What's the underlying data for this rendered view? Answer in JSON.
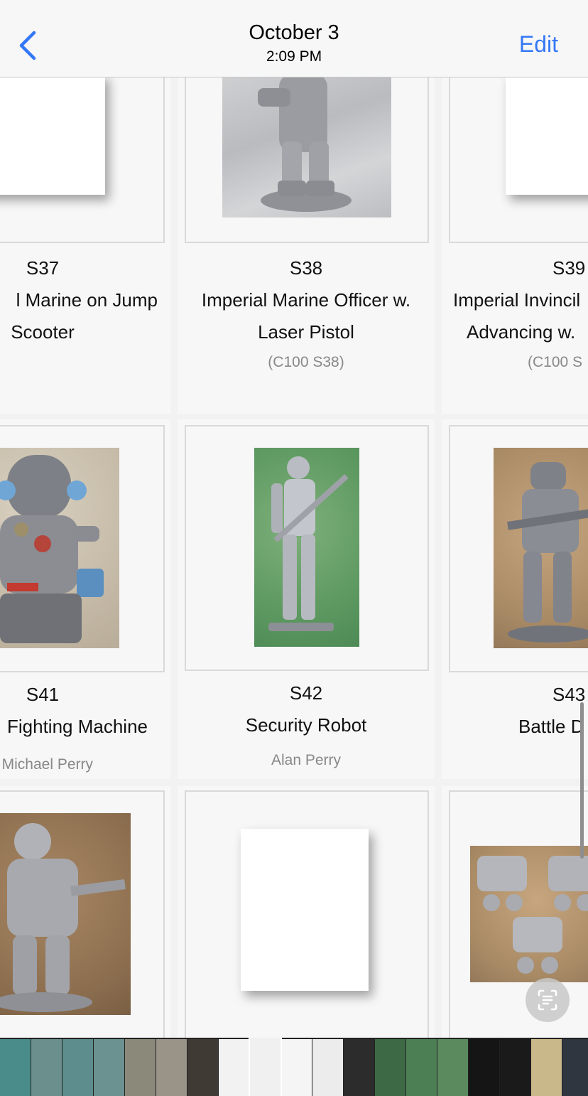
{
  "header": {
    "back_icon": "chevron-left-icon",
    "title": "October 3",
    "subtitle": "2:09 PM",
    "edit_label": "Edit",
    "accent_color": "#3478f6"
  },
  "cards": [
    {
      "code": "S37",
      "name_lines": [
        "l Marine on Jump",
        "Scooter"
      ],
      "sub": "",
      "image": "blank-page"
    },
    {
      "code": "S38",
      "name_lines": [
        "Imperial Marine Officer w.",
        "Laser Pistol"
      ],
      "sub": "(C100 S38)",
      "image": "miniature-photo"
    },
    {
      "code": "S39",
      "name_lines": [
        "Imperial Invincil",
        "Advancing w."
      ],
      "sub": "(C100 S",
      "image": "blank-page"
    },
    {
      "code": "S41",
      "name_lines": [
        "Fighting Machine"
      ],
      "sub": "Michael Perry",
      "image": "miniature-photo"
    },
    {
      "code": "S42",
      "name_lines": [
        "Security Robot"
      ],
      "sub": "Alan Perry",
      "image": "miniature-photo"
    },
    {
      "code": "S43",
      "name_lines": [
        "Battle D"
      ],
      "sub": "",
      "image": "miniature-photo"
    },
    {
      "code": "",
      "name_lines": [],
      "sub": "",
      "image": "miniature-photo"
    },
    {
      "code": "",
      "name_lines": [],
      "sub": "",
      "image": "blank-page"
    },
    {
      "code": "",
      "name_lines": [],
      "sub": "",
      "image": "miniature-photo"
    }
  ],
  "scan_button_icon": "text-scan-icon",
  "thumbnail_strip": {
    "thumb_colors": [
      "#4a8c8a",
      "#6a8f8c",
      "#5d8d8c",
      "#6b9290",
      "#8b8a7a",
      "#9a9488",
      "#3f3a34",
      "#f2f2f2",
      "#f0f0f0",
      "#f5f5f5",
      "#ececec",
      "#2c2c2c",
      "#3d6a45",
      "#4d7f55",
      "#5a8a5e",
      "#151515",
      "#1a1a1a",
      "#c9b98a",
      "#2f3640",
      "#b0703f"
    ],
    "current_index": 8
  }
}
